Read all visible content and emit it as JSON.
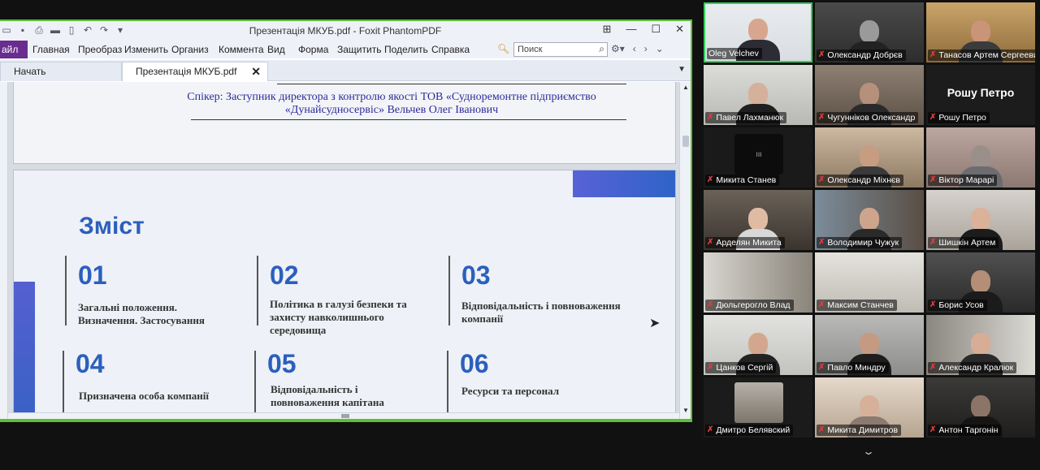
{
  "foxit": {
    "window_title": "Презентація МКУБ.pdf - Foxit PhantomPDF",
    "file_menu": "айл",
    "menu": [
      "Главная",
      "Преобраз",
      "Изменить",
      "Организ",
      "Коммента",
      "Вид",
      "Форма",
      "Защитить",
      "Поделить",
      "Справка"
    ],
    "search_placeholder": "Поиск",
    "tabs": [
      "Начать",
      "Презентація МКУБ.pdf"
    ],
    "tab_close": "✕"
  },
  "page1": {
    "speaker_line1": "Спікер: Заступник директора з контролю якості ТОВ «Судноремонтне підприємство",
    "speaker_line2": "«Дунайсудносервіс» Вельчев Олег Іванович"
  },
  "page2": {
    "heading": "Зміст",
    "items": [
      {
        "num": "01",
        "text": "Загальні положення. Визначення. Застосування"
      },
      {
        "num": "02",
        "text": "Політика в галузі безпеки та захисту навколишнього середовища"
      },
      {
        "num": "03",
        "text": "Відповідальність і повноваження компанії"
      },
      {
        "num": "04",
        "text": "Призначена особа компанії"
      },
      {
        "num": "05",
        "text": "Відповідальність і повноваження капітана"
      },
      {
        "num": "06",
        "text": "Ресурси та персонал"
      }
    ]
  },
  "participants": [
    {
      "name": "Oleg Velchev",
      "muted": false
    },
    {
      "name": "Олександр Добрєв",
      "muted": true
    },
    {
      "name": "Танасов Артем Сергеевич",
      "muted": true
    },
    {
      "name": "Павел Лахманюк",
      "muted": true
    },
    {
      "name": "Чугунніков Олександр",
      "muted": true
    },
    {
      "name": "Рошу Петро",
      "muted": true,
      "big_name": "Рошу Петро"
    },
    {
      "name": "Микита Станев",
      "muted": true,
      "small_label": "ווו"
    },
    {
      "name": "Олександр Міхнєв",
      "muted": true
    },
    {
      "name": "Віктор Марарі",
      "muted": true
    },
    {
      "name": "Арделян Микита",
      "muted": true
    },
    {
      "name": "Володимир Чужук",
      "muted": true
    },
    {
      "name": "Шишкін Артем",
      "muted": true
    },
    {
      "name": "Дюльгерогло Влад",
      "muted": true
    },
    {
      "name": "Максим Станчев",
      "muted": true
    },
    {
      "name": "Борис Усов",
      "muted": true
    },
    {
      "name": "Цанков Сергій",
      "muted": true
    },
    {
      "name": "Павло Миндру",
      "muted": true
    },
    {
      "name": "Александр Кралюк",
      "muted": true
    },
    {
      "name": "Дмитро  Белявский",
      "muted": true
    },
    {
      "name": "Микита Димитров",
      "muted": true
    },
    {
      "name": "Антон Таргонін",
      "muted": true
    }
  ],
  "icons": {
    "muted_mic": "mic-muted-icon",
    "expand": "chevron-down-icon"
  },
  "colors": {
    "talking_border": "#33d15a",
    "heading_blue": "#2c5fbd",
    "file_tab": "#6a2c8f",
    "speaker_text": "#2d2b9a"
  }
}
